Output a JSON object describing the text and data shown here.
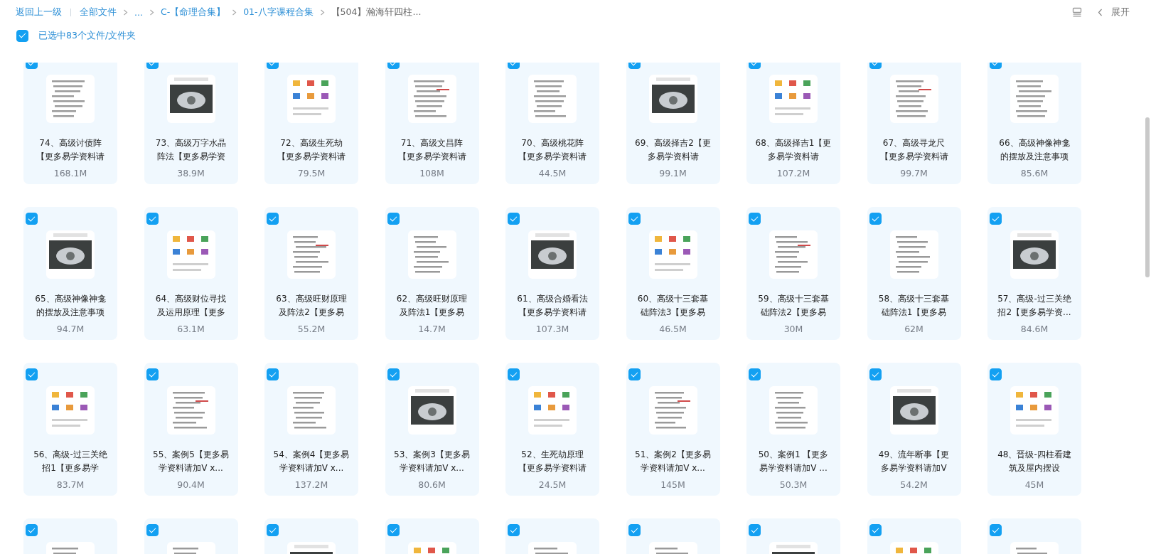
{
  "breadcrumb": {
    "back": "返回上一级",
    "items": [
      {
        "label": "全部文件",
        "current": false
      },
      {
        "label": "...",
        "current": false
      },
      {
        "label": "C-【命理合集】",
        "current": false
      },
      {
        "label": "01-八字课程合集",
        "current": false
      },
      {
        "label": "【504】瀚海轩四柱...",
        "current": true
      }
    ]
  },
  "expand": {
    "label": "展开"
  },
  "selection": {
    "selected": true,
    "label": "已选中83个文件/文件夹"
  },
  "files": [
    {
      "name": "74、高级讨债阵【更多易学资料请",
      "size": "168.1M",
      "selected": true
    },
    {
      "name": "73、高级万字水晶阵法【更多易学资",
      "size": "38.9M",
      "selected": true
    },
    {
      "name": "72、高级生死劫【更多易学资料请",
      "size": "79.5M",
      "selected": true
    },
    {
      "name": "71、高级文昌阵【更多易学资料请",
      "size": "108M",
      "selected": true
    },
    {
      "name": "70、高级桃花阵【更多易学资料请",
      "size": "44.5M",
      "selected": true
    },
    {
      "name": "69、高级择吉2【更多易学资料请",
      "size": "99.1M",
      "selected": true
    },
    {
      "name": "68、高级择吉1【更多易学资料请",
      "size": "107.2M",
      "selected": true
    },
    {
      "name": "67、高级寻龙尺【更多易学资料请",
      "size": "99.7M",
      "selected": true
    },
    {
      "name": "66、高级神像神龛的摆放及注意事项",
      "size": "85.6M",
      "selected": true
    },
    {
      "name": "65、高级神像神龛的摆放及注意事项",
      "size": "94.7M",
      "selected": true
    },
    {
      "name": "64、高级财位寻找及运用原理【更多",
      "size": "63.1M",
      "selected": true
    },
    {
      "name": "63、高级旺财原理及阵法2【更多易",
      "size": "55.2M",
      "selected": true
    },
    {
      "name": "62、高级旺财原理及阵法1【更多易",
      "size": "14.7M",
      "selected": true
    },
    {
      "name": "61、高级合婚看法【更多易学资料请",
      "size": "107.3M",
      "selected": true
    },
    {
      "name": "60、高级十三套基础阵法3【更多易",
      "size": "46.5M",
      "selected": true
    },
    {
      "name": "59、高级十三套基础阵法2【更多易",
      "size": "30M",
      "selected": true
    },
    {
      "name": "58、高级十三套基础阵法1【更多易",
      "size": "62M",
      "selected": true
    },
    {
      "name": "57、高级-过三关绝招2【更多易学资...",
      "size": "84.6M",
      "selected": true
    },
    {
      "name": "56、高级-过三关绝招1【更多易学",
      "size": "83.7M",
      "selected": true
    },
    {
      "name": "55、案例5【更多易学资料请加V x...",
      "size": "90.4M",
      "selected": true
    },
    {
      "name": "54、案例4【更多易学资料请加V x...",
      "size": "137.2M",
      "selected": true
    },
    {
      "name": "53、案例3【更多易学资料请加V x...",
      "size": "80.6M",
      "selected": true
    },
    {
      "name": "52、生死劫原理【更多易学资料请",
      "size": "24.5M",
      "selected": true
    },
    {
      "name": "51、案例2【更多易学资料请加V x...",
      "size": "145M",
      "selected": true
    },
    {
      "name": "50、案例1 【更多易学资料请加V ...",
      "size": "50.3M",
      "selected": true
    },
    {
      "name": "49、流年断事【更多易学资料请加V",
      "size": "54.2M",
      "selected": true
    },
    {
      "name": "48、晋级-四柱看建筑及屋内摆设",
      "size": "45M",
      "selected": true
    },
    {
      "selected": true
    },
    {
      "selected": true
    },
    {
      "selected": true
    },
    {
      "selected": true
    },
    {
      "selected": true
    },
    {
      "selected": true
    },
    {
      "selected": true
    },
    {
      "selected": true
    },
    {
      "selected": true
    }
  ]
}
